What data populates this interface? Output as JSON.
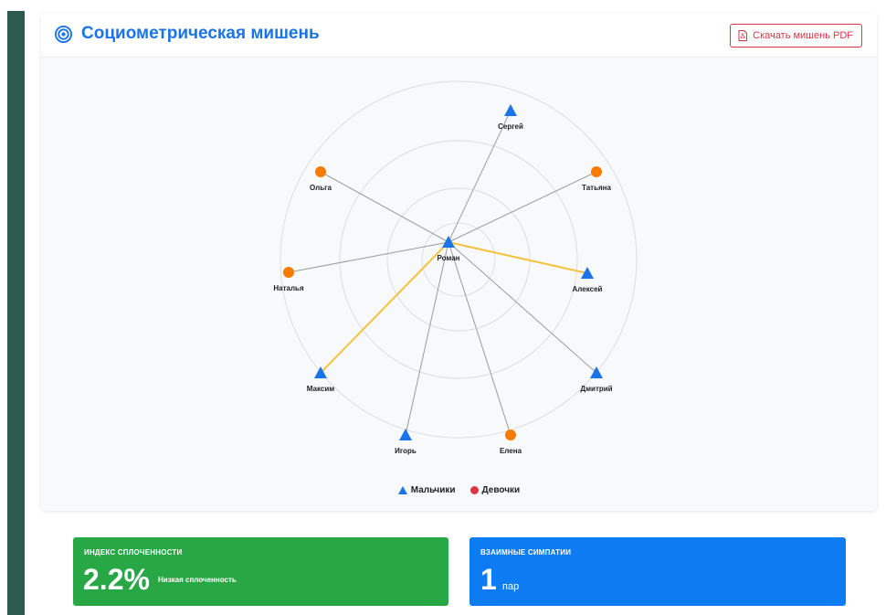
{
  "header": {
    "title": "Социометрическая мишень",
    "pdf_button_label": "Скачать мишень PDF",
    "title_icon": "bullseye-icon",
    "pdf_icon": "pdf-file-icon"
  },
  "colors": {
    "brand_blue": "#1a73e8",
    "boys": "#1a73e8",
    "girls": "#f57c00",
    "girls_legend": "#dc3545",
    "mutual_edge": "#f5c242",
    "edge": "#9a9a9a",
    "green_card": "#28a745",
    "blue_card": "#0d7cf2",
    "sidebar": "#2e5a4e"
  },
  "target": {
    "center": "Роман",
    "nodes": [
      {
        "id": "roman",
        "name": "Роман",
        "gender": "boy"
      },
      {
        "id": "sergey",
        "name": "Сергей",
        "gender": "boy"
      },
      {
        "id": "tatyana",
        "name": "Татьяна",
        "gender": "girl"
      },
      {
        "id": "aleksey",
        "name": "Алексей",
        "gender": "boy"
      },
      {
        "id": "dmitry",
        "name": "Дмитрий",
        "gender": "boy"
      },
      {
        "id": "elena",
        "name": "Елена",
        "gender": "girl"
      },
      {
        "id": "igor",
        "name": "Игорь",
        "gender": "boy"
      },
      {
        "id": "maksim",
        "name": "Максим",
        "gender": "boy"
      },
      {
        "id": "natalya",
        "name": "Наталья",
        "gender": "girl"
      },
      {
        "id": "olga",
        "name": "Ольга",
        "gender": "girl"
      }
    ],
    "edges": [
      {
        "from": "roman",
        "to": "sergey",
        "mutual": false
      },
      {
        "from": "roman",
        "to": "tatyana",
        "mutual": false
      },
      {
        "from": "roman",
        "to": "aleksey",
        "mutual": true
      },
      {
        "from": "roman",
        "to": "dmitry",
        "mutual": false
      },
      {
        "from": "roman",
        "to": "elena",
        "mutual": false
      },
      {
        "from": "roman",
        "to": "igor",
        "mutual": false
      },
      {
        "from": "roman",
        "to": "maksim",
        "mutual": true
      },
      {
        "from": "roman",
        "to": "natalya",
        "mutual": false
      },
      {
        "from": "roman",
        "to": "olga",
        "mutual": false
      }
    ]
  },
  "legend": {
    "boys": "Мальчики",
    "girls": "Девочки"
  },
  "stats": {
    "cohesion": {
      "label": "ИНДЕКС СПЛОЧЕННОСТИ",
      "value": "2.2%",
      "note": "Низкая сплоченность"
    },
    "mutual": {
      "label": "ВЗАИМНЫЕ СИМПАТИИ",
      "value": "1",
      "unit": "пар"
    }
  }
}
